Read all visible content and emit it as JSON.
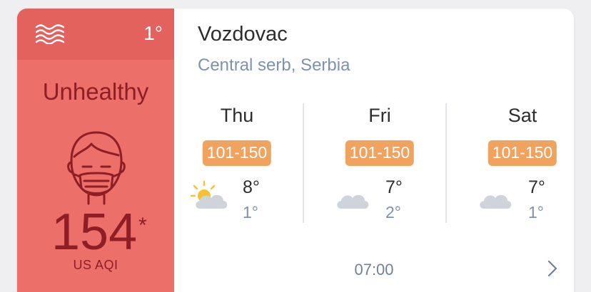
{
  "aqi": {
    "current_temp": "1°",
    "status": "Unhealthy",
    "value": "154",
    "value_marker": "*",
    "unit": "US AQI",
    "panel_color": "#ec6f6a",
    "text_color": "#8e1e24"
  },
  "location": {
    "city": "Vozdovac",
    "region": "Central serb, Serbia"
  },
  "forecast": [
    {
      "day": "Thu",
      "aqi_range": "101-150",
      "icon": "partly-sunny-icon",
      "high": "8°",
      "low": "1°"
    },
    {
      "day": "Fri",
      "aqi_range": "101-150",
      "icon": "cloud-icon",
      "high": "7°",
      "low": "2°"
    },
    {
      "day": "Sat",
      "aqi_range": "101-150",
      "icon": "cloud-icon",
      "high": "7°",
      "low": "1°"
    }
  ],
  "updated_time": "07:00",
  "colors": {
    "badge": "#f0a25f",
    "accent_blue": "#7c93ab"
  }
}
